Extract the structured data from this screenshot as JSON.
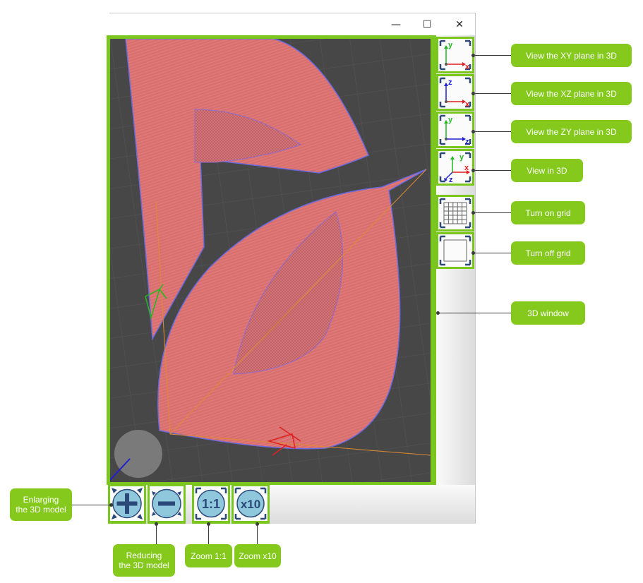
{
  "window": {
    "minimize_glyph": "—",
    "maximize_glyph": "☐",
    "close_glyph": "✕"
  },
  "side_toolbar": [
    {
      "name": "view-xy-button",
      "icon": "axes-xy-icon",
      "axes": [
        "y",
        "x"
      ],
      "callout": "View the XY plane in 3D"
    },
    {
      "name": "view-xz-button",
      "icon": "axes-xz-icon",
      "axes": [
        "z",
        "x"
      ],
      "callout": "View the XZ plane in 3D"
    },
    {
      "name": "view-zy-button",
      "icon": "axes-zy-icon",
      "axes": [
        "y",
        "z"
      ],
      "callout": "View the ZY plane in 3D"
    },
    {
      "name": "view-3d-button",
      "icon": "axes-3d-icon",
      "axes": [
        "y",
        "x",
        "z"
      ],
      "callout": "View in 3D"
    },
    {
      "name": "grid-on-button",
      "icon": "grid-on-icon",
      "callout": "Turn on grid"
    },
    {
      "name": "grid-off-button",
      "icon": "grid-off-icon",
      "callout": "Turn off grid"
    }
  ],
  "viewport": {
    "callout": "3D window"
  },
  "bottom_toolbar": [
    {
      "name": "zoom-in-button",
      "icon": "plus-icon",
      "label": "",
      "callout": "Enlarging\nthe 3D model"
    },
    {
      "name": "zoom-out-button",
      "icon": "minus-icon",
      "label": "",
      "callout": "Reducing\nthe 3D model"
    },
    {
      "name": "zoom-1-1-button",
      "icon": "zoom-1-1-icon",
      "label": "1:1",
      "callout": "Zoom 1:1"
    },
    {
      "name": "zoom-x10-button",
      "icon": "zoom-x10-icon",
      "label": "x10",
      "callout": "Zoom x10"
    }
  ],
  "colors": {
    "accent": "#7ac51e",
    "callout": "#84c91c",
    "scene_bg": "#474747",
    "model_fill": "#d9706f",
    "model_outline": "#6a6adf",
    "axis_x": "#e02020",
    "axis_y": "#22b822",
    "axis_z": "#2020d0"
  }
}
